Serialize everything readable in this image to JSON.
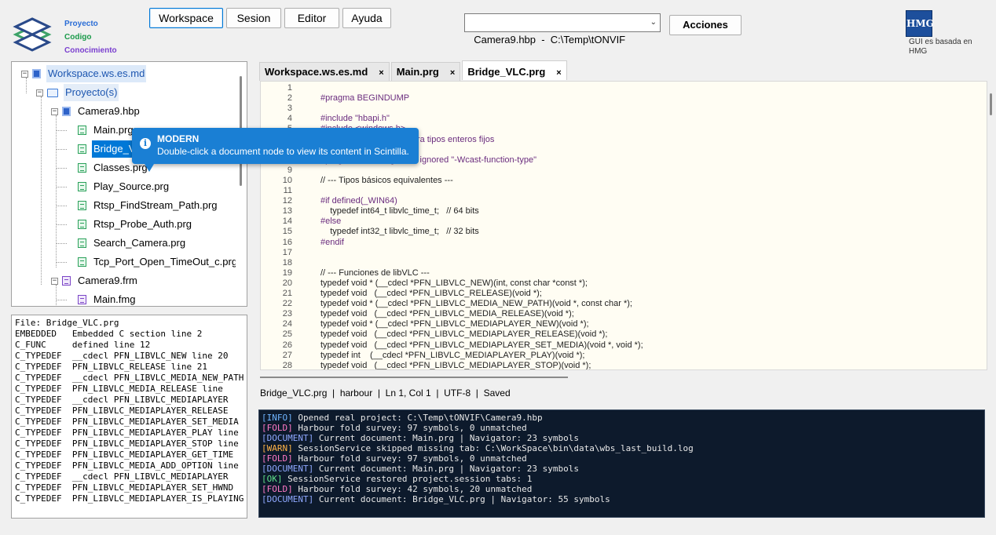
{
  "branding": {
    "lines": [
      "Proyecto",
      "Codigo",
      "Conocimiento"
    ],
    "hmg_logo": "HMG",
    "hmg_text": "GUI es basada en HMG"
  },
  "menu": [
    {
      "label": "Workspace",
      "active": true
    },
    {
      "label": "Sesion",
      "active": false
    },
    {
      "label": "Editor",
      "active": false
    },
    {
      "label": "Ayuda",
      "active": false
    }
  ],
  "project_select": {
    "value": "Camera9.hbp  -  C:\\Temp\\tONVIF"
  },
  "acciones_label": "Acciones",
  "tree": [
    {
      "label": "Workspace.ws.es.md",
      "type": "ws"
    },
    {
      "label": "Proyecto(s)",
      "type": "folder"
    },
    {
      "label": "Camera9.hbp",
      "type": "hbp"
    },
    {
      "label": "Main.prg",
      "type": "prg"
    },
    {
      "label": "Bridge_VLC.prg",
      "type": "prg"
    },
    {
      "label": "Classes.prg",
      "type": "prg"
    },
    {
      "label": "Play_Source.prg",
      "type": "prg"
    },
    {
      "label": "Rtsp_FindStream_Path.prg",
      "type": "prg"
    },
    {
      "label": "Rtsp_Probe_Auth.prg",
      "type": "prg"
    },
    {
      "label": "Search_Camera.prg",
      "type": "prg"
    },
    {
      "label": "Tcp_Port_Open_TimeOut_c.prg",
      "type": "prg"
    },
    {
      "label": "Camera9.frm",
      "type": "frm"
    },
    {
      "label": "Main.fmg",
      "type": "frm"
    }
  ],
  "tooltip": {
    "title": "MODERN",
    "text": "Double-click a document node to view its content in Scintilla."
  },
  "symbols": [
    "File: Bridge_VLC.prg",
    "EMBEDDED   Embedded C section line 2",
    "C_FUNC     defined line 12",
    "C_TYPEDEF  __cdecl PFN_LIBVLC_NEW line 20",
    "C_TYPEDEF  PFN_LIBVLC_RELEASE line 21",
    "C_TYPEDEF  __cdecl PFN_LIBVLC_MEDIA_NEW_PATH",
    "C_TYPEDEF  PFN_LIBVLC_MEDIA_RELEASE line",
    "C_TYPEDEF  __cdecl PFN_LIBVLC_MEDIAPLAYER",
    "C_TYPEDEF  PFN_LIBVLC_MEDIAPLAYER_RELEASE",
    "C_TYPEDEF  PFN_LIBVLC_MEDIAPLAYER_SET_MEDIA",
    "C_TYPEDEF  PFN_LIBVLC_MEDIAPLAYER_PLAY line",
    "C_TYPEDEF  PFN_LIBVLC_MEDIAPLAYER_STOP line",
    "C_TYPEDEF  PFN_LIBVLC_MEDIAPLAYER_GET_TIME",
    "C_TYPEDEF  PFN_LIBVLC_MEDIA_ADD_OPTION line",
    "C_TYPEDEF  __cdecl PFN_LIBVLC_MEDIAPLAYER",
    "C_TYPEDEF  PFN_LIBVLC_MEDIAPLAYER_SET_HWND",
    "C_TYPEDEF  PFN_LIBVLC_MEDIAPLAYER_IS_PLAYING"
  ],
  "tabs": [
    {
      "label": "Workspace.ws.es.md",
      "active": false
    },
    {
      "label": "Main.prg",
      "active": false
    },
    {
      "label": "Bridge_VLC.prg",
      "active": true
    }
  ],
  "tab_close": "×",
  "code": [
    {
      "n": "1",
      "t": ""
    },
    {
      "n": "2",
      "t": "#pragma BEGINDUMP"
    },
    {
      "n": "3",
      "t": ""
    },
    {
      "n": "4",
      "t": "#include \"hbapi.h\""
    },
    {
      "n": "5",
      "t": "#include <windows.h>"
    },
    {
      "n": "6",
      "t": "#include <stdint.h>   // para tipos enteros fijos"
    },
    {
      "n": "7",
      "t": ""
    },
    {
      "n": "8",
      "t": "#pragma GCC diagnostic ignored \"-Wcast-function-type\""
    },
    {
      "n": "9",
      "t": ""
    },
    {
      "n": "10",
      "t": "// --- Tipos básicos equivalentes ---"
    },
    {
      "n": "11",
      "t": ""
    },
    {
      "n": "12",
      "t": "#if defined(_WIN64)"
    },
    {
      "n": "13",
      "t": "    typedef int64_t libvlc_time_t;   // 64 bits"
    },
    {
      "n": "14",
      "t": "#else"
    },
    {
      "n": "15",
      "t": "    typedef int32_t libvlc_time_t;   // 32 bits"
    },
    {
      "n": "16",
      "t": "#endif"
    },
    {
      "n": "17",
      "t": ""
    },
    {
      "n": "18",
      "t": ""
    },
    {
      "n": "19",
      "t": "// --- Funciones de libVLC ---"
    },
    {
      "n": "20",
      "t": "typedef void * (__cdecl *PFN_LIBVLC_NEW)(int, const char *const *);"
    },
    {
      "n": "21",
      "t": "typedef void   (__cdecl *PFN_LIBVLC_RELEASE)(void *);"
    },
    {
      "n": "22",
      "t": "typedef void * (__cdecl *PFN_LIBVLC_MEDIA_NEW_PATH)(void *, const char *);"
    },
    {
      "n": "23",
      "t": "typedef void   (__cdecl *PFN_LIBVLC_MEDIA_RELEASE)(void *);"
    },
    {
      "n": "24",
      "t": "typedef void * (__cdecl *PFN_LIBVLC_MEDIAPLAYER_NEW)(void *);"
    },
    {
      "n": "25",
      "t": "typedef void   (__cdecl *PFN_LIBVLC_MEDIAPLAYER_RELEASE)(void *);"
    },
    {
      "n": "26",
      "t": "typedef void   (__cdecl *PFN_LIBVLC_MEDIAPLAYER_SET_MEDIA)(void *, void *);"
    },
    {
      "n": "27",
      "t": "typedef int    (__cdecl *PFN_LIBVLC_MEDIAPLAYER_PLAY)(void *);"
    },
    {
      "n": "28",
      "t": "typedef void   (__cdecl *PFN_LIBVLC_MEDIAPLAYER_STOP)(void *);"
    }
  ],
  "status": "Bridge_VLC.prg  |  harbour  |  Ln 1, Col 1  |  UTF-8  |  Saved",
  "log": [
    {
      "tag": "[INFO]",
      "cls": "tag-info",
      "text": " Opened real project: C:\\Temp\\tONVIF\\Camera9.hbp"
    },
    {
      "tag": "[FOLD]",
      "cls": "tag-fold",
      "text": " Harbour fold survey: 97 symbols, 0 unmatched"
    },
    {
      "tag": "[DOCUMENT]",
      "cls": "tag-doc",
      "text": " Current document: Main.prg | Navigator: 23 symbols"
    },
    {
      "tag": "[WARN]",
      "cls": "tag-warn",
      "text": " SessionService skipped missing tab: C:\\WorkSpace\\bin\\data\\wbs_last_build.log"
    },
    {
      "tag": "[FOLD]",
      "cls": "tag-fold",
      "text": " Harbour fold survey: 97 symbols, 0 unmatched"
    },
    {
      "tag": "[DOCUMENT]",
      "cls": "tag-doc",
      "text": " Current document: Main.prg | Navigator: 23 symbols"
    },
    {
      "tag": "[OK]",
      "cls": "tag-ok",
      "text": " SessionService restored project.session tabs: 1"
    },
    {
      "tag": "[FOLD]",
      "cls": "tag-fold",
      "text": " Harbour fold survey: 42 symbols, 20 unmatched"
    },
    {
      "tag": "[DOCUMENT]",
      "cls": "tag-doc",
      "text": " Current document: Bridge_VLC.prg | Navigator: 55 symbols"
    }
  ]
}
